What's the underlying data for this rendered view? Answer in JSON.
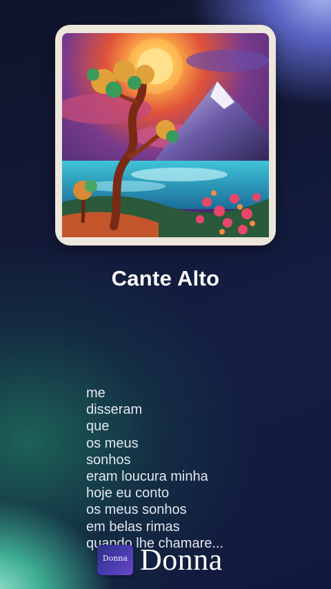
{
  "song": {
    "title": "Cante Alto"
  },
  "lyrics": [
    "me",
    "disseram",
    "que",
    "os meus",
    "sonhos",
    "eram loucura minha",
    "hoje eu conto",
    "os meus sonhos",
    "em belas rimas",
    "quando lhe chamare..."
  ],
  "brand": {
    "badge_text": "Donna",
    "name": "Donna",
    "badge_color": "#3a36a0"
  },
  "cover": {
    "description_icon": "cover-art-image"
  }
}
